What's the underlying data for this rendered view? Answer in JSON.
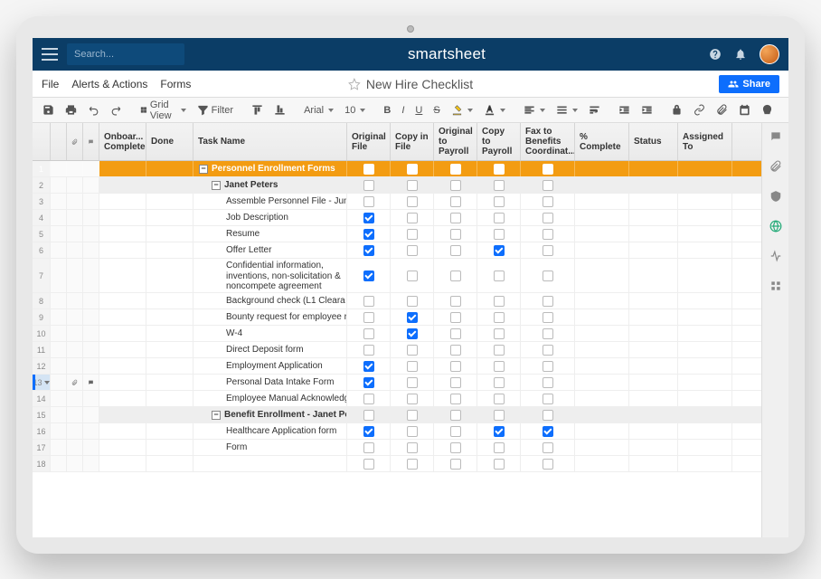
{
  "topbar": {
    "search_placeholder": "Search...",
    "brand": "smartsheet"
  },
  "menubar": {
    "file": "File",
    "alerts": "Alerts & Actions",
    "forms": "Forms",
    "title": "New Hire Checklist",
    "share": "Share"
  },
  "toolbar": {
    "grid_view": "Grid View",
    "filter": "Filter",
    "font": "Arial",
    "size": "10"
  },
  "columns": {
    "onboard": "Onboar... Complete",
    "done": "Done",
    "task": "Task Name",
    "original_file": "Original File",
    "copy_in_file": "Copy in File",
    "original_to_payroll": "Original to Payroll",
    "copy_to_payroll": "Copy to Payroll",
    "fax": "Fax to Benefits Coordinat...",
    "pct": "% Complete",
    "status": "Status",
    "assigned": "Assigned To"
  },
  "rows": [
    {
      "num": 1,
      "indent": 0,
      "class": "orange boldrow",
      "toggle": true,
      "task": "Personnel Enrollment Forms",
      "cbx": [
        false,
        false,
        false,
        false,
        false
      ],
      "white": true
    },
    {
      "num": 2,
      "indent": 1,
      "class": "gray boldrow",
      "toggle": true,
      "task": "Janet Peters",
      "cbx": [
        false,
        false,
        false,
        false,
        false
      ]
    },
    {
      "num": 3,
      "indent": 2,
      "task": "Assemble Personnel File - Jun",
      "cbx": [
        false,
        false,
        false,
        false,
        false
      ]
    },
    {
      "num": 4,
      "indent": 2,
      "task": "Job Description",
      "cbx": [
        true,
        false,
        false,
        false,
        false
      ]
    },
    {
      "num": 5,
      "indent": 2,
      "task": "Resume",
      "cbx": [
        true,
        false,
        false,
        false,
        false
      ]
    },
    {
      "num": 6,
      "indent": 2,
      "task": "Offer Letter",
      "cbx": [
        true,
        false,
        false,
        true,
        false
      ]
    },
    {
      "num": 7,
      "indent": 2,
      "tall": true,
      "task": "Confidential information, inventions, non-solicitation & noncompete agreement",
      "cbx": [
        true,
        false,
        false,
        false,
        false
      ]
    },
    {
      "num": 8,
      "indent": 2,
      "task": "Background check (L1 Cleara",
      "cbx": [
        false,
        false,
        false,
        false,
        false
      ]
    },
    {
      "num": 9,
      "indent": 2,
      "task": "Bounty request for employee r",
      "cbx": [
        false,
        true,
        false,
        false,
        false
      ]
    },
    {
      "num": 10,
      "indent": 2,
      "task": "W-4",
      "cbx": [
        false,
        true,
        false,
        false,
        false
      ]
    },
    {
      "num": 11,
      "indent": 2,
      "task": "Direct Deposit form",
      "cbx": [
        false,
        false,
        false,
        false,
        false
      ]
    },
    {
      "num": 12,
      "indent": 2,
      "task": "Employment Application",
      "cbx": [
        true,
        false,
        false,
        false,
        false
      ]
    },
    {
      "num": 13,
      "indent": 2,
      "task": "Personal Data Intake Form",
      "cbx": [
        true,
        false,
        false,
        false,
        false
      ],
      "selected": true,
      "showIcons": true
    },
    {
      "num": 14,
      "indent": 2,
      "task": "Employee Manual Acknowledg",
      "cbx": [
        false,
        false,
        false,
        false,
        false
      ]
    },
    {
      "num": 15,
      "indent": 1,
      "class": "gray boldrow",
      "toggle": true,
      "task": "Benefit Enrollment - Janet Peters",
      "cbx": [
        false,
        false,
        false,
        false,
        false
      ]
    },
    {
      "num": 16,
      "indent": 2,
      "task": "Healthcare Application form",
      "cbx": [
        true,
        false,
        false,
        true,
        true
      ]
    },
    {
      "num": 17,
      "indent": 2,
      "task": "Form",
      "cbx": [
        false,
        false,
        false,
        false,
        false
      ]
    },
    {
      "num": 18,
      "indent": 2,
      "task": "",
      "cbx": [
        false,
        false,
        false,
        false,
        false
      ]
    }
  ]
}
